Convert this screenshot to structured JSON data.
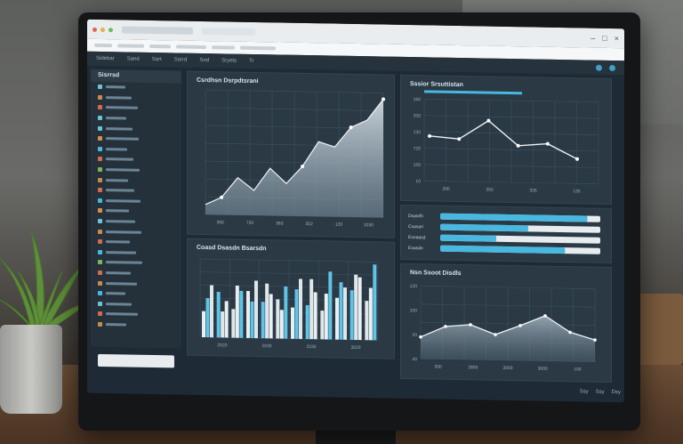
{
  "scene": {
    "description_colors": {
      "accent": "#49b8e0",
      "panel": "#2a3944",
      "screen": "#1e2a35"
    }
  },
  "window": {
    "menu_items": [
      "Sidebar",
      "Sand",
      "Sort",
      "Sorrd",
      "Sod",
      "Sryets",
      "Tr"
    ]
  },
  "sidebar": {
    "title": "Sisrrsd",
    "item_colors": [
      "#6bc3d6",
      "#c98b4a",
      "#d46a4f",
      "#6bc3d6",
      "#6bc3d6",
      "#d98e4a",
      "#49b8e0",
      "#d46a4f",
      "#7fb45a",
      "#c98b4a",
      "#d46a4f",
      "#49b8e0",
      "#d98e4a",
      "#6bc3d6",
      "#c98b4a",
      "#d46a4f",
      "#49b8e0",
      "#7fb45a",
      "#d46a4f",
      "#c98b4a",
      "#49b8e0",
      "#6bc3d6",
      "#d46a4f",
      "#c98b4a"
    ]
  },
  "panels": {
    "area": {
      "title": "Csrdhsn Dsrpdtsrani"
    },
    "line": {
      "title": "Sssior Srsuttistan"
    },
    "bars": {
      "title": "Coasd Dsasdn Bsarsdn"
    },
    "area2": {
      "title": "Nsn Ssoot Disdls"
    }
  },
  "chart_data": [
    {
      "type": "area",
      "title": "Csrdhsn Dsrpdtsrani",
      "categories": [
        "360",
        "720",
        "360",
        "352",
        "120",
        "1030"
      ],
      "x": [
        0,
        1,
        2,
        3,
        4,
        5,
        6,
        7,
        8,
        9,
        10,
        11
      ],
      "values": [
        8,
        14,
        30,
        20,
        38,
        26,
        40,
        60,
        56,
        72,
        78,
        95
      ],
      "ylim": [
        0,
        100
      ]
    },
    {
      "type": "line",
      "title": "Sssior Srsuttistan",
      "categories": [
        "200",
        "350",
        "335",
        "135"
      ],
      "yticks": [
        "10",
        "150",
        "720",
        "130",
        "200",
        "160"
      ],
      "values": [
        55,
        52,
        75,
        45,
        48,
        30
      ],
      "ylim": [
        0,
        100
      ]
    },
    {
      "type": "bar",
      "title": "Coasd Dsasdn Bsarsdn",
      "categories": [
        "2020",
        "2030",
        "2035",
        "3020"
      ],
      "series": [
        {
          "values": [
            20,
            35,
            22,
            36,
            28,
            30,
            24,
            26,
            22,
            32,
            38,
            30
          ]
        },
        {
          "values": [
            30,
            20,
            40,
            28,
            42,
            22,
            38,
            46,
            35,
            44,
            50,
            40
          ]
        },
        {
          "values": [
            40,
            28,
            36,
            44,
            34,
            40,
            46,
            36,
            52,
            40,
            48,
            58
          ]
        }
      ],
      "ylim": [
        0,
        60
      ]
    },
    {
      "type": "area",
      "title": "Nsn Ssoot Disdls",
      "categories": [
        "300",
        "2800",
        "3000",
        "3000",
        "100"
      ],
      "yticks": [
        "40",
        "20",
        "100",
        "120"
      ],
      "values": [
        30,
        45,
        48,
        35,
        48,
        62,
        40,
        30
      ],
      "ylim": [
        0,
        100
      ]
    }
  ],
  "progress": {
    "labels": [
      "Dsasrlh",
      "Csasari",
      "Esnaasd",
      "Esasdn"
    ],
    "fractions": [
      0.92,
      0.55,
      0.35,
      0.78
    ]
  },
  "bottom": {
    "items": [
      "Ssy",
      "Ssy",
      "Dsy"
    ]
  }
}
